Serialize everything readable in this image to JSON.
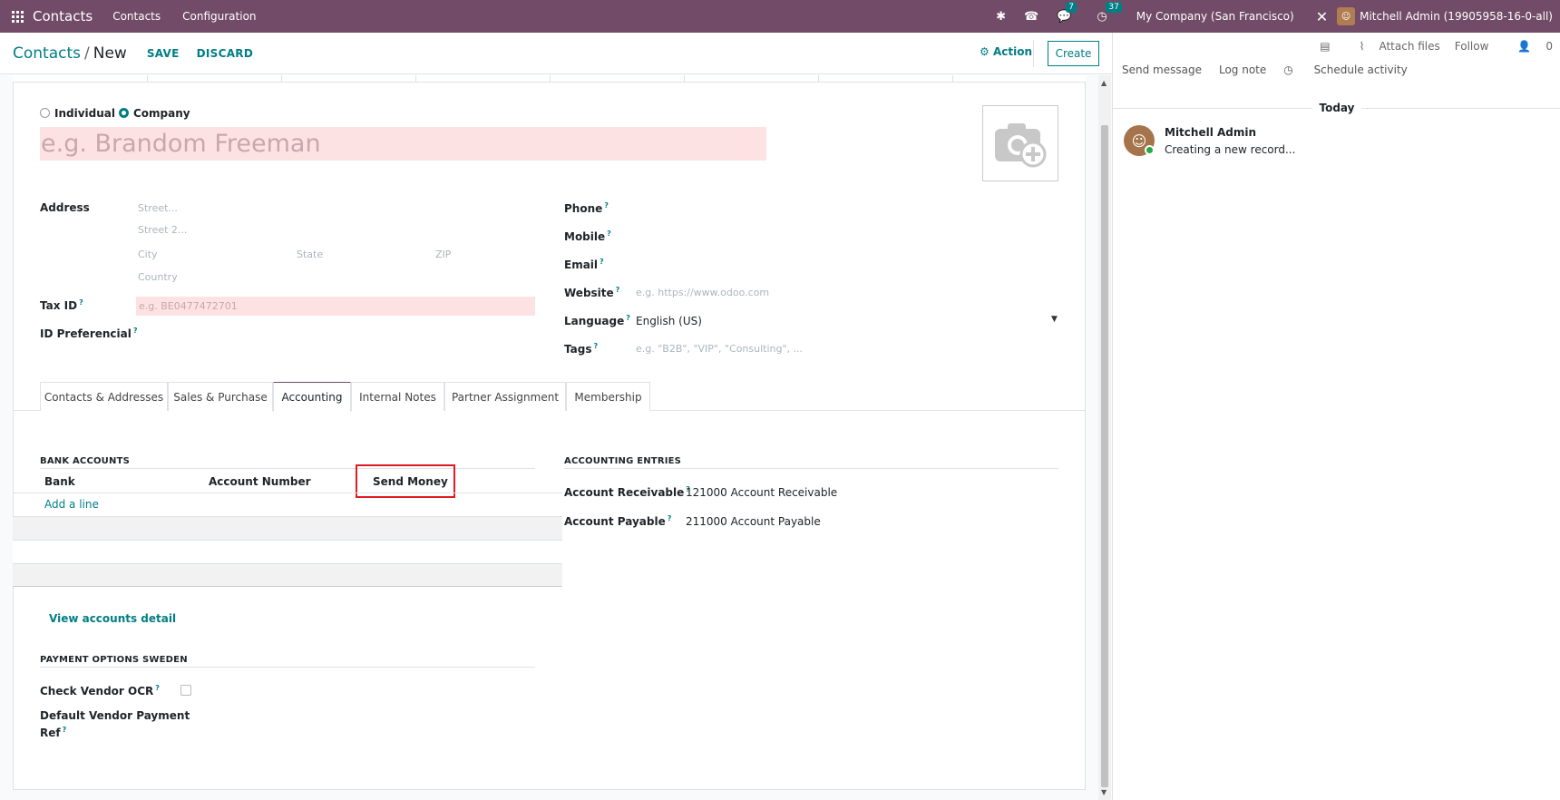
{
  "navbar": {
    "brand": "Contacts",
    "menus": [
      "Contacts",
      "Configuration"
    ],
    "messages_count": "7",
    "activities_count": "37",
    "company": "My Company (San Francisco)",
    "user": "Mitchell Admin (19905958-16-0-all)"
  },
  "control": {
    "breadcrumb_parent": "Contacts",
    "breadcrumb_sep": "/",
    "breadcrumb_current": "New",
    "save": "SAVE",
    "discard": "DISCARD",
    "action": "Action",
    "create": "Create"
  },
  "form": {
    "type_individual": "Individual",
    "type_company": "Company",
    "selected_type": "Company",
    "name_placeholder": "e.g. Brandom Freeman",
    "address_label": "Address",
    "street_ph": "Street...",
    "street2_ph": "Street 2...",
    "city_ph": "City",
    "state_ph": "State",
    "zip_ph": "ZIP",
    "country_ph": "Country",
    "taxid_label": "Tax ID",
    "taxid_ph": "e.g. BE0477472701",
    "idpref_label": "ID Preferencial",
    "phone_label": "Phone",
    "mobile_label": "Mobile",
    "email_label": "Email",
    "website_label": "Website",
    "website_ph": "e.g. https://www.odoo.com",
    "language_label": "Language",
    "language_value": "English (US)",
    "tags_label": "Tags",
    "tags_ph": "e.g. \"B2B\", \"VIP\", \"Consulting\", ...",
    "help_mark": "?"
  },
  "tabs": [
    "Contacts & Addresses",
    "Sales & Purchase",
    "Accounting",
    "Internal Notes",
    "Partner Assignment",
    "Membership"
  ],
  "active_tab": "Accounting",
  "accounting": {
    "bank_title": "BANK ACCOUNTS",
    "col_bank": "Bank",
    "col_account": "Account Number",
    "col_send": "Send Money",
    "add_line": "Add a line",
    "view_detail": "View accounts detail",
    "entries_title": "ACCOUNTING ENTRIES",
    "receivable_label": "Account Receivable",
    "receivable_value": "121000 Account Receivable",
    "payable_label": "Account Payable",
    "payable_value": "211000 Account Payable",
    "sweden_title": "PAYMENT OPTIONS SWEDEN",
    "ocr_label": "Check Vendor OCR",
    "ref_label_1": "Default Vendor Payment",
    "ref_label_2": "Ref"
  },
  "chatter": {
    "attach": "Attach files",
    "follow": "Follow",
    "followers": "0",
    "send_message": "Send message",
    "log_note": "Log note",
    "schedule": "Schedule activity",
    "today": "Today",
    "author": "Mitchell Admin",
    "body": "Creating a new record..."
  },
  "colors": {
    "brand": "#714b67",
    "accent": "#017e84",
    "required_bg": "#fde2e4",
    "highlight": "#e01b24"
  }
}
